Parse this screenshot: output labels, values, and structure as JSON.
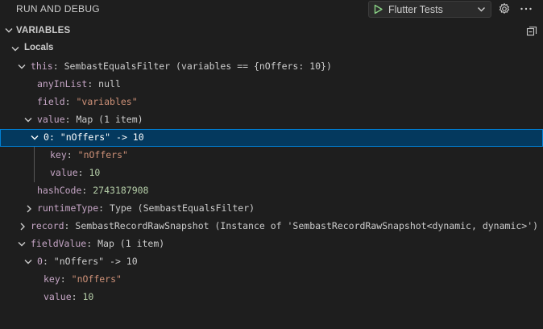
{
  "header": {
    "title": "RUN AND DEBUG",
    "config_label": "Flutter Tests",
    "play_color": "#89d185"
  },
  "variables": {
    "section_title": "VARIABLES",
    "scope_label": "Locals",
    "rows": [
      {
        "key": "this",
        "sep": ": ",
        "value": "SembastEqualsFilter (variables == {nOffers: 10})",
        "kind": "obj"
      },
      {
        "key": "anyInList",
        "sep": ": ",
        "value": "null",
        "kind": "obj"
      },
      {
        "key": "field",
        "sep": ": ",
        "value": "\"variables\"",
        "kind": "str"
      },
      {
        "key": "value",
        "sep": ": ",
        "value": "Map (1 item)",
        "kind": "obj"
      },
      {
        "key": "0",
        "sep": ": ",
        "value": "\"nOffers\" -> 10",
        "kind": "plain"
      },
      {
        "key": "key",
        "sep": ": ",
        "value": "\"nOffers\"",
        "kind": "str"
      },
      {
        "key": "value",
        "sep": ": ",
        "value": "10",
        "kind": "num"
      },
      {
        "key": "hashCode",
        "sep": ": ",
        "value": "2743187908",
        "kind": "num"
      },
      {
        "key": "runtimeType",
        "sep": ": ",
        "value": "Type (SembastEqualsFilter)",
        "kind": "obj"
      },
      {
        "key": "record",
        "sep": ": ",
        "value": "SembastRecordRawSnapshot (Instance of 'SembastRecordRawSnapshot<dynamic, dynamic>')",
        "kind": "obj"
      },
      {
        "key": "fieldValue",
        "sep": ": ",
        "value": "Map (1 item)",
        "kind": "obj"
      },
      {
        "key": "0",
        "sep": ": ",
        "value": "\"nOffers\" -> 10",
        "kind": "plain"
      },
      {
        "key": "key",
        "sep": ": ",
        "value": "\"nOffers\"",
        "kind": "str"
      },
      {
        "key": "value",
        "sep": ": ",
        "value": "10",
        "kind": "num"
      }
    ]
  }
}
